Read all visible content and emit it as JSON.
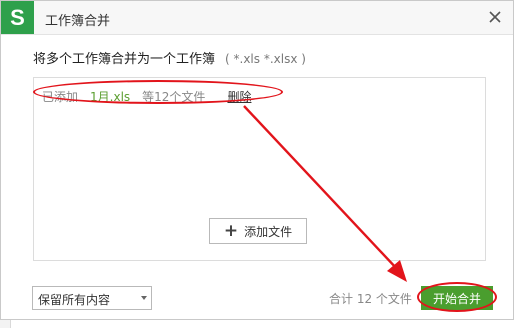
{
  "dialog": {
    "title": "工作簿合并",
    "logo_glyph": "S",
    "icons": {
      "logo": "wps-logo-icon",
      "close": "close-icon",
      "add": "plus-icon",
      "dropdown": "chevron-down-icon"
    }
  },
  "main": {
    "instruction": "将多个工作簿合并为一个工作簿",
    "hint": "( *.xls *.xlsx )",
    "file_list": {
      "added_label": "已添加",
      "file_name": "1月.xls",
      "count_text": "等12个文件",
      "delete_label": "删除"
    },
    "add_file_label": "添加文件"
  },
  "footer": {
    "select_value": "保留所有内容",
    "total_text": "合计 12 个文件",
    "start_label": "开始合并"
  },
  "colors": {
    "logo_green": "#2ea04b",
    "accent_green": "#4a9e2e",
    "annotation_red": "#e2141b"
  }
}
